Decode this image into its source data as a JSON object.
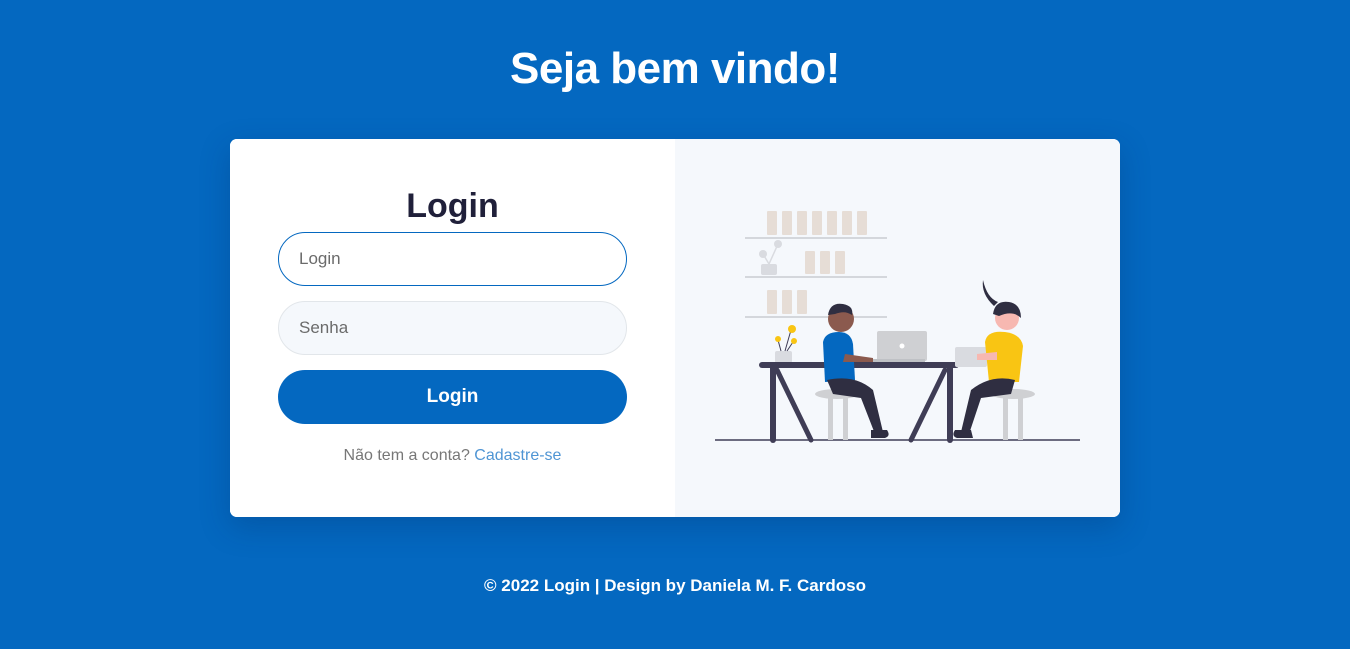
{
  "header": {
    "title": "Seja bem vindo!"
  },
  "form": {
    "title": "Login",
    "login_placeholder": "Login",
    "password_placeholder": "Senha",
    "submit_label": "Login",
    "signup_prompt": "Não tem a conta?",
    "signup_link": "Cadastre-se"
  },
  "illustration": {
    "icon": "people-working-at-desk-illustration"
  },
  "footer": {
    "text": "© 2022 Login | Design by Daniela M. F. Cardoso"
  },
  "colors": {
    "background": "#0468c0",
    "accent": "#0468c0",
    "card": "#ffffff",
    "illustration_panel": "#f5f8fc",
    "link": "#4f95d4"
  }
}
